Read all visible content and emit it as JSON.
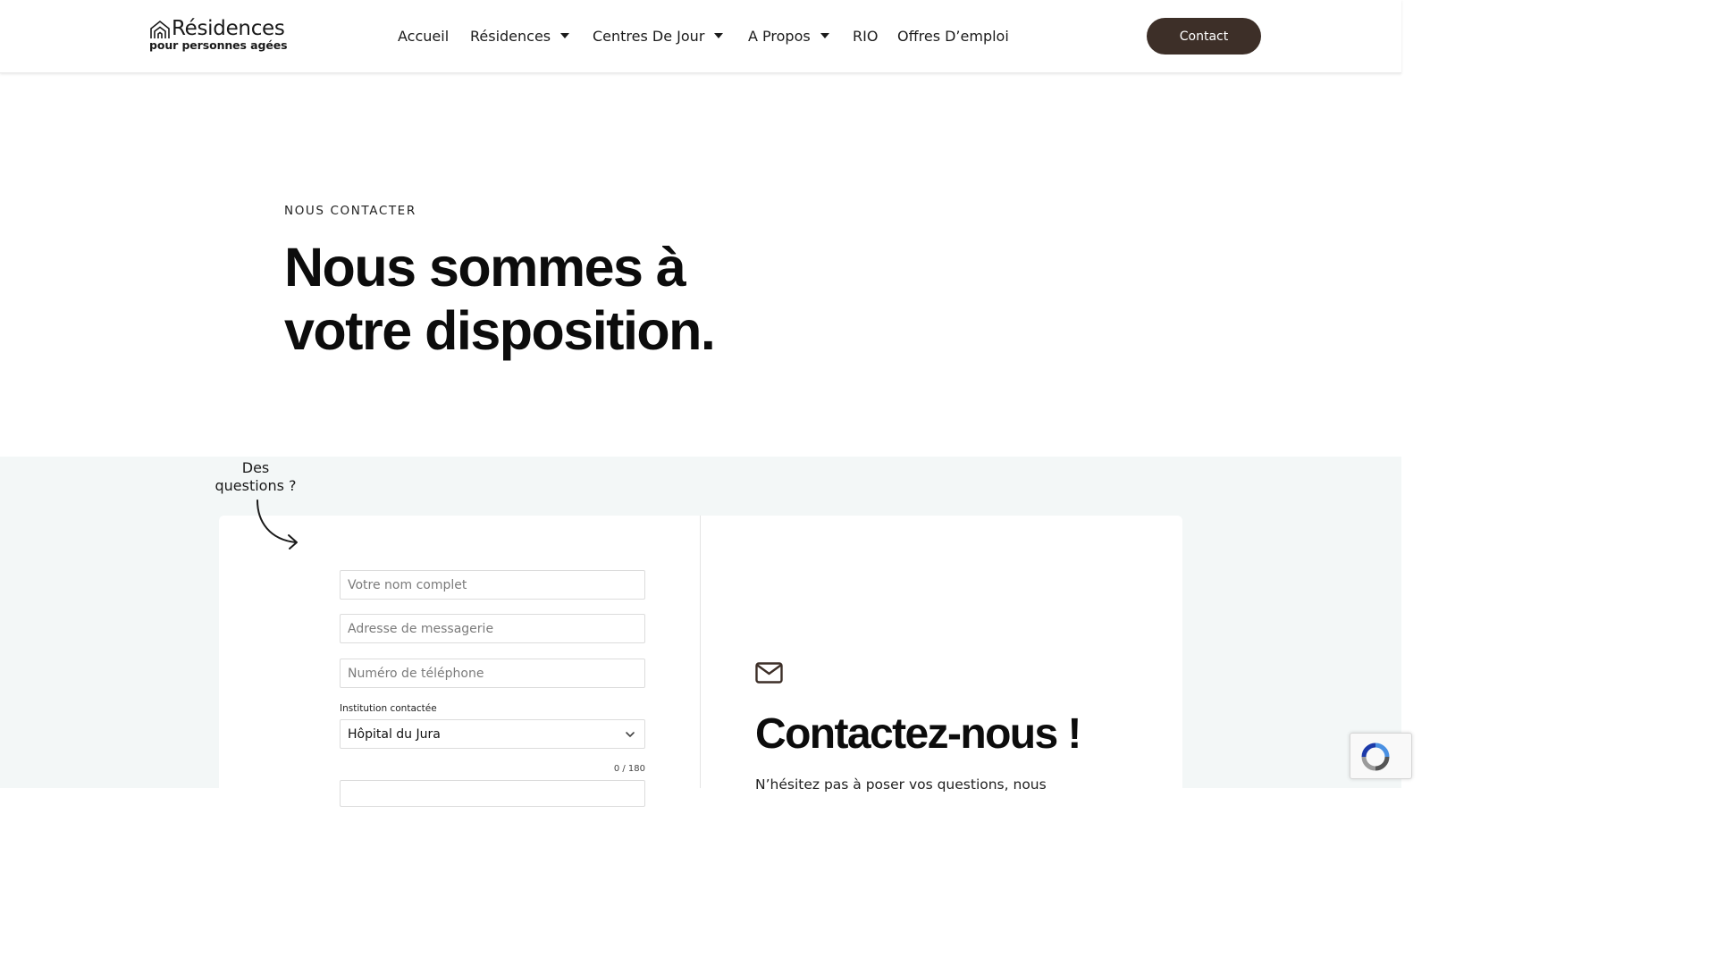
{
  "header": {
    "logo": {
      "title": "Résidences",
      "subtitle": "pour personnes agées"
    },
    "nav": [
      {
        "label": "Accueil",
        "dropdown": false
      },
      {
        "label": "Résidences",
        "dropdown": true
      },
      {
        "label": "Centres De Jour",
        "dropdown": true
      },
      {
        "label": "A Propos",
        "dropdown": true
      },
      {
        "label": "RIO",
        "dropdown": false
      },
      {
        "label": "Offres D’emploi",
        "dropdown": false
      }
    ],
    "contact_button": "Contact"
  },
  "hero": {
    "eyebrow": "NOUS CONTACTER",
    "title_line1": "Nous sommes à",
    "title_line2": "votre disposition."
  },
  "form": {
    "questions_label_line1": "Des",
    "questions_label_line2": "questions ?",
    "name_placeholder": "Votre nom complet",
    "email_placeholder": "Adresse de messagerie",
    "phone_placeholder": "Numéro de téléphone",
    "institution_label": "Institution contactée",
    "institution_value": "Hôpital du Jura",
    "char_counter": "0 / 180"
  },
  "contact_panel": {
    "icon": "mail-icon",
    "title": "Contactez-nous !",
    "text": "N’hésitez pas à poser vos questions, nous"
  },
  "colors": {
    "brand_dark": "#3d2f28",
    "section_bg": "#f3f7f7"
  }
}
